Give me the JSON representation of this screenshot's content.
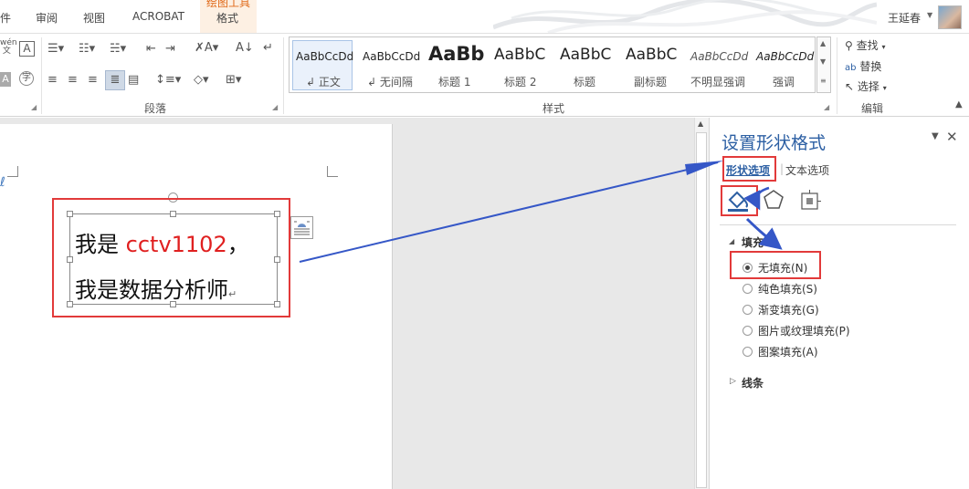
{
  "tabs": [
    {
      "label": "件"
    },
    {
      "label": "审阅"
    },
    {
      "label": "视图"
    },
    {
      "label": "ACROBAT"
    },
    {
      "label": "格式"
    }
  ],
  "context_tab_label": "绘图工具",
  "user": {
    "name": "王延春"
  },
  "ribbon": {
    "groups": {
      "paragraph": "段落",
      "styles": "样式",
      "editing": "编辑"
    },
    "styles": [
      {
        "sample": "AaBbCcDd",
        "name": "↲ 正文"
      },
      {
        "sample": "AaBbCcDd",
        "name": "↲ 无间隔"
      },
      {
        "sample": "AaBb",
        "name": "标题 1"
      },
      {
        "sample": "AaBbC",
        "name": "标题 2"
      },
      {
        "sample": "AaBbC",
        "name": "标题"
      },
      {
        "sample": "AaBbC",
        "name": "副标题"
      },
      {
        "sample": "AaBbCcDd",
        "name": "不明显强调"
      },
      {
        "sample": "AaBbCcDd",
        "name": "强调"
      }
    ],
    "editing": {
      "find": "查找",
      "replace": "替换",
      "select": "选择"
    },
    "font_hint": "wén\n文"
  },
  "document": {
    "textbox_line1_prefix": "我是 ",
    "textbox_line1_highlight": "cctv1102",
    "textbox_line1_suffix": "，",
    "textbox_line2": "我是数据分析师",
    "paragraph_mark": "↵"
  },
  "pane": {
    "title": "设置形状格式",
    "tab_shape": "形状选项",
    "tab_text": "文本选项",
    "fill_section": "填充",
    "line_section": "线条",
    "fill_options": [
      {
        "label": "无填充(N)",
        "checked": true
      },
      {
        "label": "纯色填充(S)",
        "checked": false
      },
      {
        "label": "渐变填充(G)",
        "checked": false
      },
      {
        "label": "图片或纹理填充(P)",
        "checked": false
      },
      {
        "label": "图案填充(A)",
        "checked": false
      }
    ]
  },
  "colors": {
    "annotation_red": "#e23a3a",
    "arrow_blue": "#3557c7",
    "pane_title_blue": "#2c5fa3",
    "highlight_red_text": "#e02020"
  }
}
